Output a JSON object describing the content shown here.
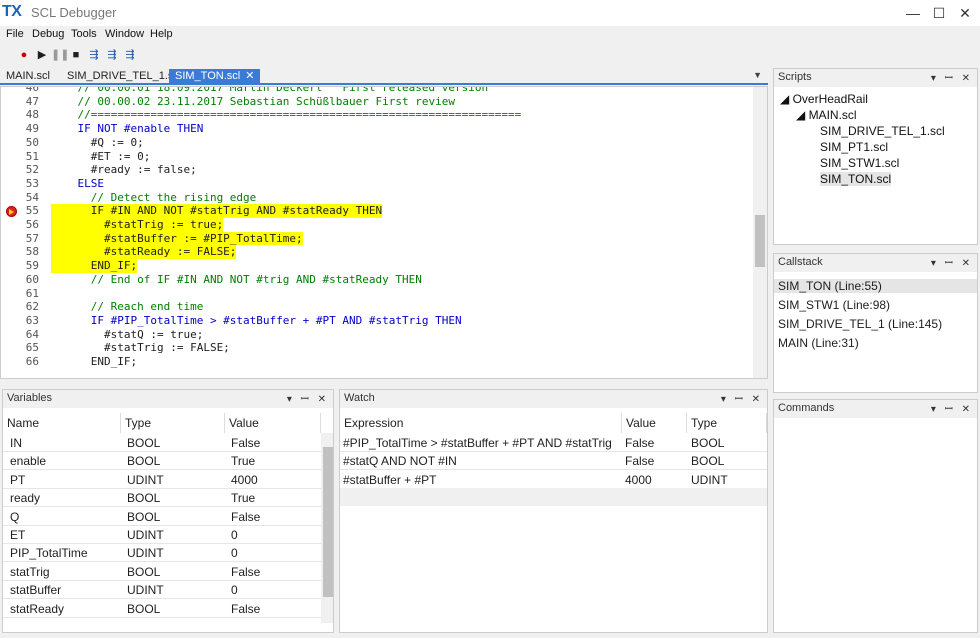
{
  "app": {
    "logo": "TX",
    "title": "SCL Debugger",
    "min": "—",
    "max": "☐",
    "close": "✕"
  },
  "menu": [
    "File",
    "Debug",
    "Tools",
    "Window",
    "Help"
  ],
  "tabs": [
    {
      "label": "MAIN.scl"
    },
    {
      "label": "SIM_DRIVE_TEL_1.scl"
    },
    {
      "label": "SIM_TON.scl",
      "close": "✕"
    }
  ],
  "code": [
    {
      "n": "46",
      "t": "    // 00.00.01 18.09.2017 Martin Deckert   First released version",
      "c": "cm"
    },
    {
      "n": "47",
      "t": "    // 00.00.02 23.11.2017 Sebastian Schüßlbauer First review",
      "c": "cm"
    },
    {
      "n": "48",
      "t": "    //=================================================================",
      "c": "cm"
    },
    {
      "n": "49",
      "t": "    IF NOT #enable THEN",
      "c": "kw"
    },
    {
      "n": "50",
      "t": "      #Q := 0;",
      "c": ""
    },
    {
      "n": "51",
      "t": "      #ET := 0;",
      "c": ""
    },
    {
      "n": "52",
      "t": "      #ready := false;",
      "c": ""
    },
    {
      "n": "53",
      "t": "    ELSE",
      "c": "kw"
    },
    {
      "n": "54",
      "t": "      // Detect the rising edge",
      "c": "cm"
    },
    {
      "n": "55",
      "t": "      IF #IN AND NOT #statTrig AND #statReady THEN",
      "c": "hl"
    },
    {
      "n": "56",
      "t": "        #statTrig := true;",
      "c": "hl"
    },
    {
      "n": "57",
      "t": "        #statBuffer := #PIP_TotalTime;",
      "c": "hl"
    },
    {
      "n": "58",
      "t": "        #statReady := FALSE;",
      "c": "hl"
    },
    {
      "n": "59",
      "t": "      END_IF;",
      "c": "hl"
    },
    {
      "n": "60",
      "t": "      // End of IF #IN AND NOT #trig AND #statReady THEN",
      "c": "cm"
    },
    {
      "n": "61",
      "t": "",
      "c": ""
    },
    {
      "n": "62",
      "t": "      // Reach end time",
      "c": "cm"
    },
    {
      "n": "63",
      "t": "      IF #PIP_TotalTime > #statBuffer + #PT AND #statTrig THEN",
      "c": "kw"
    },
    {
      "n": "64",
      "t": "        #statQ := true;",
      "c": ""
    },
    {
      "n": "65",
      "t": "        #statTrig := FALSE;",
      "c": ""
    },
    {
      "n": "66",
      "t": "      END_IF;",
      "c": ""
    }
  ],
  "scripts": {
    "title": "Scripts",
    "root": "OverHeadRail",
    "main": "MAIN.scl",
    "files": [
      "SIM_DRIVE_TEL_1.scl",
      "SIM_PT1.scl",
      "SIM_STW1.scl",
      "SIM_TON.scl"
    ]
  },
  "callstack": {
    "title": "Callstack",
    "items": [
      "SIM_TON (Line:55)",
      "SIM_STW1 (Line:98)",
      "SIM_DRIVE_TEL_1 (Line:145)",
      "MAIN (Line:31)"
    ]
  },
  "commands": {
    "title": "Commands"
  },
  "variables": {
    "title": "Variables",
    "headers": [
      "Name",
      "Type",
      "Value"
    ],
    "rows": [
      [
        "IN",
        "BOOL",
        "False"
      ],
      [
        "enable",
        "BOOL",
        "True"
      ],
      [
        "PT",
        "UDINT",
        "4000"
      ],
      [
        "ready",
        "BOOL",
        "True"
      ],
      [
        "Q",
        "BOOL",
        "False"
      ],
      [
        "ET",
        "UDINT",
        "0"
      ],
      [
        "PIP_TotalTime",
        "UDINT",
        "0"
      ],
      [
        "statTrig",
        "BOOL",
        "False"
      ],
      [
        "statBuffer",
        "UDINT",
        "0"
      ],
      [
        "statReady",
        "BOOL",
        "False"
      ]
    ]
  },
  "watch": {
    "title": "Watch",
    "headers": [
      "Expression",
      "Value",
      "Type"
    ],
    "rows": [
      [
        "#PIP_TotalTime > #statBuffer + #PT AND #statTrig",
        "False",
        "BOOL"
      ],
      [
        "#statQ AND NOT #IN",
        "False",
        "BOOL"
      ],
      [
        "#statBuffer + #PT",
        "4000",
        "UDINT"
      ]
    ]
  },
  "panel_tools": "▾ ꟷ ✕"
}
